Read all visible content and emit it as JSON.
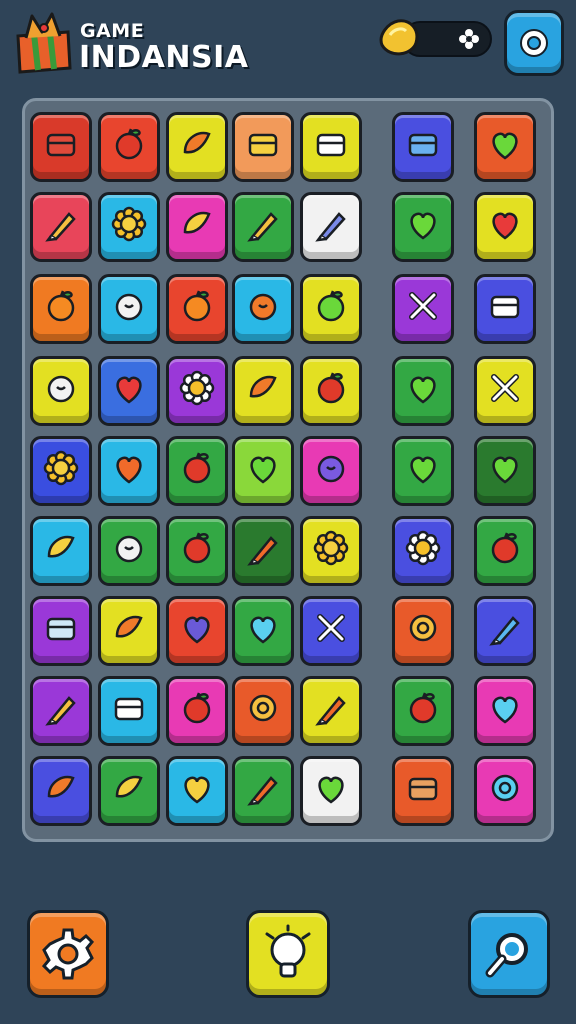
{
  "header": {
    "title_small": "GAME",
    "title_big": "INDANSIA",
    "settings_color": "#29a3e0"
  },
  "currency": {
    "icon": "gold-nugget-icon",
    "badge": "flower-icon"
  },
  "board": {
    "columns": 7,
    "rows": 9,
    "tiles": [
      [
        {
          "icon": "wallet-icon",
          "color": "#d93a2a"
        },
        {
          "icon": "apple-card-icon",
          "color": "#e8452e"
        },
        {
          "icon": "mangosteen-icon",
          "color": "#e3e022"
        },
        {
          "icon": "butter-icon",
          "color": "#f29a5a"
        },
        {
          "icon": "battery-icon",
          "color": "#e3e022"
        },
        {
          "icon": "photo-frame-icon",
          "color": "#4a4fe0"
        },
        {
          "icon": "leaf-icon",
          "color": "#e85a2a"
        }
      ],
      [
        {
          "icon": "pencil-icon",
          "color": "#e8455a"
        },
        {
          "icon": "sun-icon",
          "color": "#2ab8e6"
        },
        {
          "icon": "banana-icon",
          "color": "#e83ab4"
        },
        {
          "icon": "brush-icon",
          "color": "#33a844"
        },
        {
          "icon": "marker-icon",
          "color": "#f2f2f2"
        },
        {
          "icon": "kiwi-icon",
          "color": "#33a844"
        },
        {
          "icon": "heart-fruit-icon",
          "color": "#e3e022"
        }
      ],
      [
        {
          "icon": "orange-icon",
          "color": "#f07a22"
        },
        {
          "icon": "garlic-icon",
          "color": "#2ab8e6"
        },
        {
          "icon": "tangerine-icon",
          "color": "#e8452e"
        },
        {
          "icon": "starfish-icon",
          "color": "#2ab8e6"
        },
        {
          "icon": "green-apple-icon",
          "color": "#e3e022"
        },
        {
          "icon": "crossed-tools-icon",
          "color": "#9a38d8"
        },
        {
          "icon": "book-stack-icon",
          "color": "#4a4fe0"
        }
      ],
      [
        {
          "icon": "turtle-icon",
          "color": "#e3e022"
        },
        {
          "icon": "eggplant-icon",
          "color": "#3a6ee0"
        },
        {
          "icon": "white-flower-icon",
          "color": "#9a38d8"
        },
        {
          "icon": "papaya-icon",
          "color": "#e3e022"
        },
        {
          "icon": "red-apple-icon",
          "color": "#e3e022"
        },
        {
          "icon": "green-blob-icon",
          "color": "#33a844"
        },
        {
          "icon": "paper-plane-icon",
          "color": "#e3e022"
        }
      ],
      [
        {
          "icon": "sun-icon",
          "color": "#3a4ee0"
        },
        {
          "icon": "jelly-icon",
          "color": "#2ab8e6"
        },
        {
          "icon": "cherry-icon",
          "color": "#33a844"
        },
        {
          "icon": "melon-icon",
          "color": "#8ad83a"
        },
        {
          "icon": "radish-icon",
          "color": "#e83ab4"
        },
        {
          "icon": "lime-blob-icon",
          "color": "#33a844"
        },
        {
          "icon": "green-leaf-icon",
          "color": "#2a7a2e"
        }
      ],
      [
        {
          "icon": "lemon-icon",
          "color": "#2ab8e6"
        },
        {
          "icon": "cabbage-icon",
          "color": "#33a844"
        },
        {
          "icon": "red-apple-icon",
          "color": "#33a844"
        },
        {
          "icon": "carrot-icon",
          "color": "#2a7a2e"
        },
        {
          "icon": "sunflower-icon",
          "color": "#e3e022"
        },
        {
          "icon": "daisy-icon",
          "color": "#4a4fe0"
        },
        {
          "icon": "strawberry-icon",
          "color": "#33a844"
        }
      ],
      [
        {
          "icon": "envelope-icon",
          "color": "#9a38d8"
        },
        {
          "icon": "mango-icon",
          "color": "#e3e022"
        },
        {
          "icon": "plum-icon",
          "color": "#e8452e"
        },
        {
          "icon": "blue-egg-icon",
          "color": "#33a844"
        },
        {
          "icon": "whisk-icon",
          "color": "#4a4fe0"
        },
        {
          "icon": "swirl-icon",
          "color": "#e85a2a"
        },
        {
          "icon": "drumstick-icon",
          "color": "#4a4fe0"
        }
      ],
      [
        {
          "icon": "ice-cream-icon",
          "color": "#9a38d8"
        },
        {
          "icon": "battery-fruit-icon",
          "color": "#2ab8e6"
        },
        {
          "icon": "peach-icon",
          "color": "#e83ab4"
        },
        {
          "icon": "ring-icon",
          "color": "#e85a2a"
        },
        {
          "icon": "carrot-bunch-icon",
          "color": "#e3e022"
        },
        {
          "icon": "apple-icon",
          "color": "#33a844"
        },
        {
          "icon": "blue-ghost-icon",
          "color": "#e83ab4"
        }
      ],
      [
        {
          "icon": "croissant-icon",
          "color": "#4a4fe0"
        },
        {
          "icon": "banana-bunch-icon",
          "color": "#33a844"
        },
        {
          "icon": "yellow-blob-icon",
          "color": "#2ab8e6"
        },
        {
          "icon": "chili-icon",
          "color": "#33a844"
        },
        {
          "icon": "green-heart-icon",
          "color": "#f2f2f2"
        },
        {
          "icon": "log-icon",
          "color": "#e85a2a"
        },
        {
          "icon": "whistle-icon",
          "color": "#e83ab4"
        }
      ]
    ]
  },
  "footer": {
    "settings_color": "#f07a22",
    "hint_color": "#e3e022",
    "search_color": "#29a3e0"
  }
}
